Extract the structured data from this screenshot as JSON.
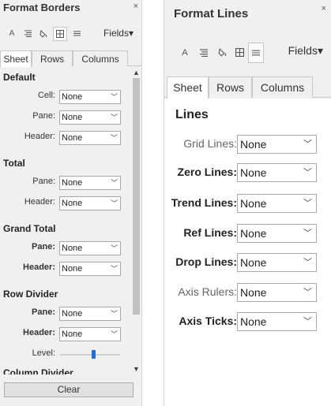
{
  "format_borders": {
    "title": "Format Borders",
    "close": "×",
    "toolbar": {
      "fields_label": "Fields",
      "dropdown_caret": "▾"
    },
    "tabs": [
      "Sheet",
      "Rows",
      "Columns"
    ],
    "sections": {
      "default": {
        "title": "Default",
        "rows": [
          {
            "label": "Cell:",
            "value": "None"
          },
          {
            "label": "Pane:",
            "value": "None"
          },
          {
            "label": "Header:",
            "value": "None"
          }
        ]
      },
      "total": {
        "title": "Total",
        "rows": [
          {
            "label": "Pane:",
            "value": "None"
          },
          {
            "label": "Header:",
            "value": "None"
          }
        ]
      },
      "grand_total": {
        "title": "Grand Total",
        "rows": [
          {
            "label": "Pane:",
            "value": "None"
          },
          {
            "label": "Header:",
            "value": "None"
          }
        ]
      },
      "row_divider": {
        "title": "Row Divider",
        "rows": [
          {
            "label": "Pane:",
            "value": "None"
          },
          {
            "label": "Header:",
            "value": "None"
          }
        ],
        "level_label": "Level:",
        "level_fraction": 0.55
      },
      "column_divider": {
        "title": "Column Divider"
      }
    },
    "clear_label": "Clear"
  },
  "format_lines": {
    "title": "Format Lines",
    "close": "×",
    "toolbar": {
      "fields_label": "Fields",
      "dropdown_caret": "▾"
    },
    "tabs": [
      "Sheet",
      "Rows",
      "Columns"
    ],
    "section_title": "Lines",
    "rows": [
      {
        "label": "Grid Lines:",
        "value": "None"
      },
      {
        "label": "Zero Lines:",
        "value": "None"
      },
      {
        "label": "Trend Lines:",
        "value": "None"
      },
      {
        "label": "Ref Lines:",
        "value": "None"
      },
      {
        "label": "Drop Lines:",
        "value": "None"
      },
      {
        "label": "Axis Rulers:",
        "value": "None"
      },
      {
        "label": "Axis Ticks:",
        "value": "None"
      }
    ]
  },
  "icons": {
    "font": "font-icon",
    "alignment": "alignment-icon",
    "shading": "shading-icon",
    "borders": "borders-icon",
    "lines": "lines-icon",
    "chevron": "chevron-down-icon"
  },
  "colors": {
    "panel_bg": "#f0f0f0",
    "content_bg": "#ffffff",
    "slider_accent": "#1f6fd1",
    "scroll_thumb": "#c1c1c1"
  }
}
